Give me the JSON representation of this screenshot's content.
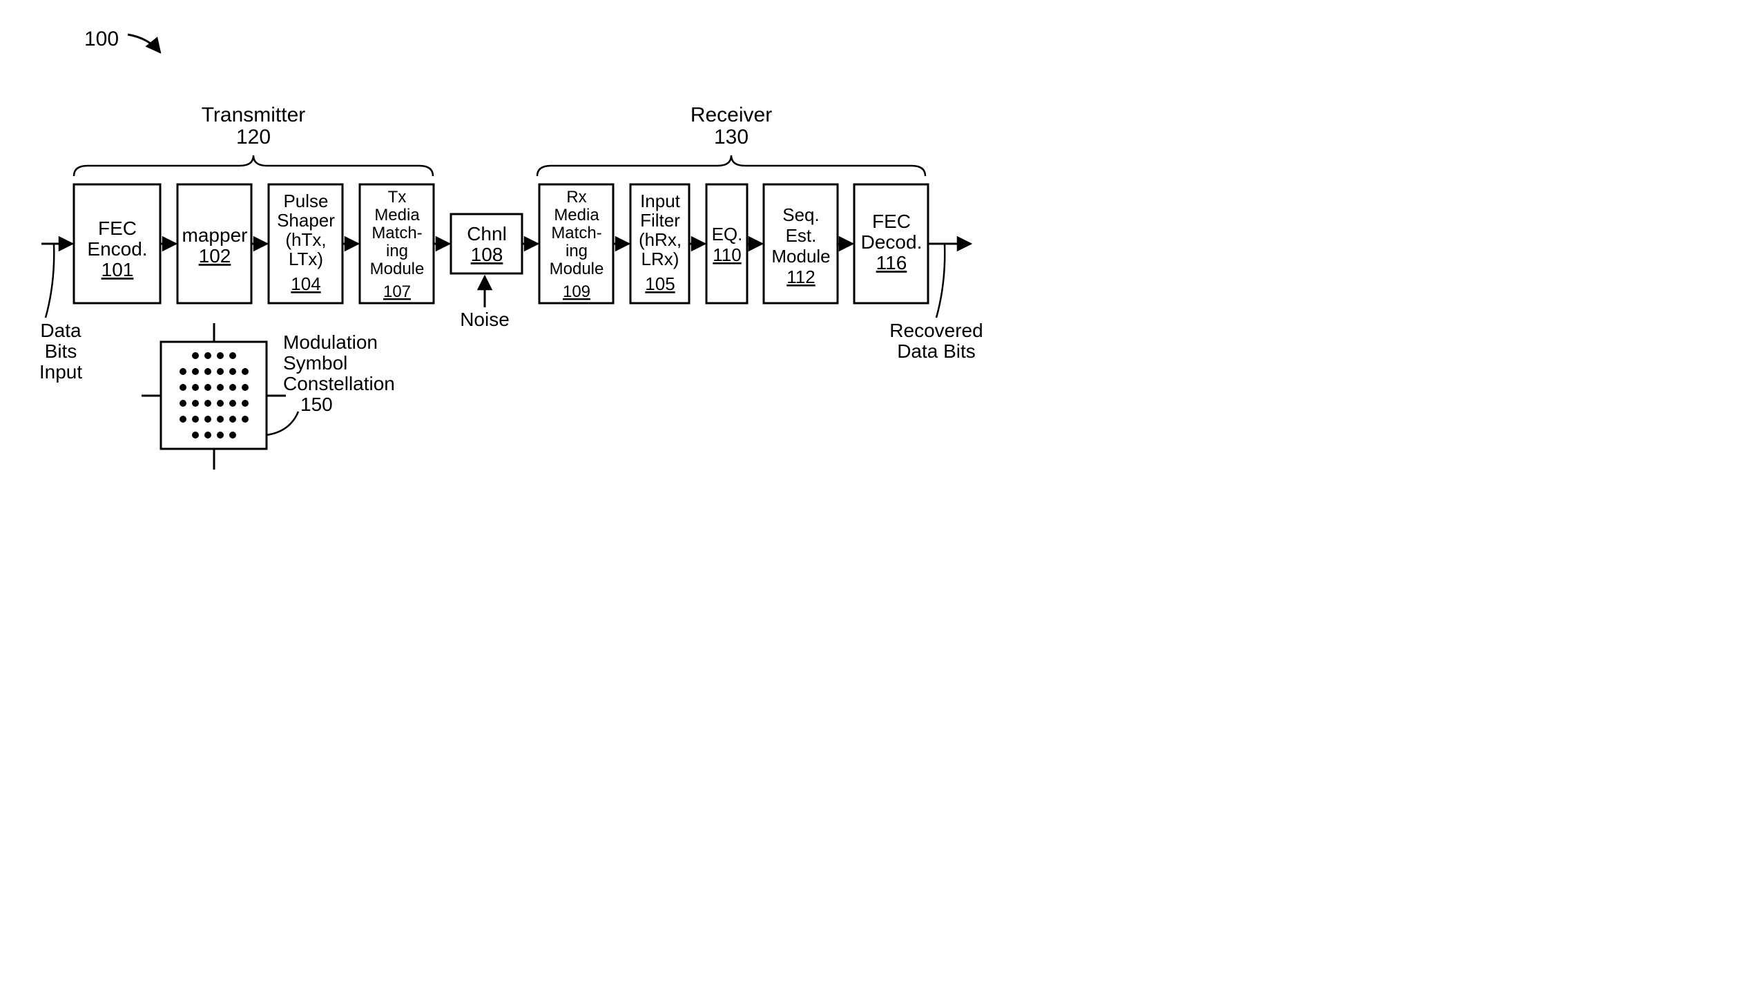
{
  "figure": {
    "ref": "100",
    "transmitter": {
      "label": "Transmitter",
      "num": "120"
    },
    "receiver": {
      "label": "Receiver",
      "num": "130"
    },
    "input_label_l1": "Data",
    "input_label_l2": "Bits",
    "input_label_l3": "Input",
    "output_label_l1": "Recovered",
    "output_label_l2": "Data Bits",
    "noise_label": "Noise",
    "constellation_l1": "Modulation",
    "constellation_l2": "Symbol",
    "constellation_l3": "Constellation",
    "constellation_num": "150"
  },
  "blocks": {
    "fec_enc": {
      "l1": "FEC",
      "l2": "Encod.",
      "num": "101"
    },
    "mapper": {
      "l1": "mapper",
      "num": "102"
    },
    "pulse": {
      "l1": "Pulse",
      "l2": "Shaper",
      "l3": "(hTx,",
      "l4": "LTx)",
      "num": "104"
    },
    "txmm": {
      "l1": "Tx",
      "l2": "Media",
      "l3": "Match-",
      "l4": "ing",
      "l5": "Module",
      "num": "107"
    },
    "chnl": {
      "l1": "Chnl",
      "num": "108"
    },
    "rxmm": {
      "l1": "Rx",
      "l2": "Media",
      "l3": "Match-",
      "l4": "ing",
      "l5": "Module",
      "num": "109"
    },
    "inflt": {
      "l1": "Input",
      "l2": "Filter",
      "l3": "(hRx,",
      "l4": "LRx)",
      "num": "105"
    },
    "eq": {
      "l1": "EQ.",
      "num": "110"
    },
    "seq": {
      "l1": "Seq.",
      "l2": "Est.",
      "l3": "Module",
      "num": "112"
    },
    "fec_dec": {
      "l1": "FEC",
      "l2": "Decod.",
      "num": "116"
    }
  }
}
